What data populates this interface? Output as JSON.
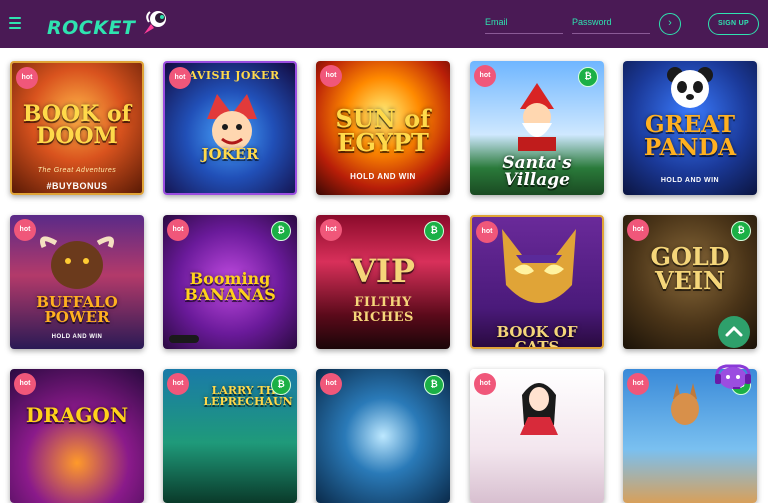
{
  "brand": {
    "name": "ROCKET",
    "accent": "#2fe3b0",
    "header_bg": "#4a1a55"
  },
  "header": {
    "email_placeholder": "Email",
    "password_placeholder": "Password",
    "submit_glyph": "›",
    "signup_label": "SIGN UP"
  },
  "badges": {
    "hot": "hot",
    "btc": "₿"
  },
  "games": [
    {
      "title": "BOOK of DOOM",
      "sub": "The Great Adventures",
      "extra": "#BUYBONUS",
      "hot": true,
      "btc": false
    },
    {
      "title": "JOKER",
      "top": "LAVISH JOKER",
      "hot": true,
      "btc": false
    },
    {
      "title": "SUN of EGYPT",
      "sub": "HOLD AND WIN",
      "hot": true,
      "btc": false
    },
    {
      "title": "Santa's Village",
      "hot": true,
      "btc": true
    },
    {
      "title": "GREAT PANDA",
      "sub": "HOLD AND WIN",
      "hot": false,
      "btc": false
    },
    {
      "title": "BUFFALO POWER",
      "sub": "HOLD AND WIN",
      "hot": true,
      "btc": false
    },
    {
      "title": "Booming BANANAS",
      "hot": true,
      "btc": true
    },
    {
      "title": "VIP",
      "sub": "FILTHY RICHES",
      "hot": true,
      "btc": true
    },
    {
      "title": "BOOK OF CATS",
      "hot": true,
      "btc": false
    },
    {
      "title": "GOLD VEIN",
      "hot": true,
      "btc": true
    },
    {
      "title": "DRAGON",
      "hot": true,
      "btc": false
    },
    {
      "title": "LARRY THE LEPRECHAUN",
      "hot": true,
      "btc": true
    },
    {
      "title": "",
      "hot": true,
      "btc": true
    },
    {
      "title": "",
      "hot": true,
      "btc": false
    },
    {
      "title": "",
      "hot": true,
      "btc": true
    }
  ],
  "icons": {
    "menu": "hamburger-icon",
    "scroll_top": "chevron-up-icon",
    "support": "headset-icon"
  }
}
